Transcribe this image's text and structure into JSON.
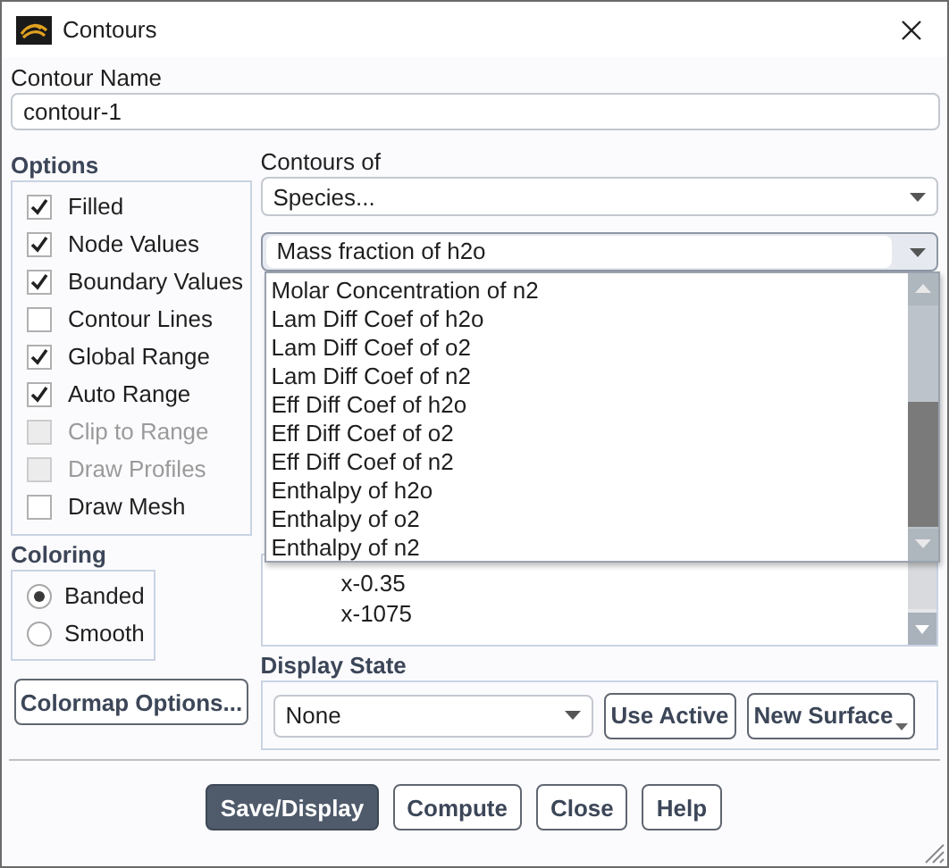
{
  "window": {
    "title": "Contours"
  },
  "contour_name": {
    "label": "Contour Name",
    "value": "contour-1"
  },
  "options": {
    "label": "Options",
    "items": [
      {
        "label": "Filled",
        "checked": true,
        "disabled": false
      },
      {
        "label": "Node Values",
        "checked": true,
        "disabled": false
      },
      {
        "label": "Boundary Values",
        "checked": true,
        "disabled": false
      },
      {
        "label": "Contour Lines",
        "checked": false,
        "disabled": false
      },
      {
        "label": "Global Range",
        "checked": true,
        "disabled": false
      },
      {
        "label": "Auto Range",
        "checked": true,
        "disabled": false
      },
      {
        "label": "Clip to Range",
        "checked": false,
        "disabled": true
      },
      {
        "label": "Draw Profiles",
        "checked": false,
        "disabled": true
      },
      {
        "label": "Draw Mesh",
        "checked": false,
        "disabled": false
      }
    ]
  },
  "coloring": {
    "label": "Coloring",
    "items": [
      {
        "label": "Banded",
        "selected": true
      },
      {
        "label": "Smooth",
        "selected": false
      }
    ]
  },
  "colormap_button": "Colormap Options...",
  "contours_of": {
    "label": "Contours of",
    "category": "Species...",
    "field": "Mass fraction of h2o",
    "expanded": true,
    "options": [
      "Molar Concentration of n2",
      "Lam Diff Coef of h2o",
      "Lam Diff Coef of o2",
      "Lam Diff Coef of n2",
      "Eff Diff Coef of h2o",
      "Eff Diff Coef of o2",
      "Eff Diff Coef of n2",
      "Enthalpy of h2o",
      "Enthalpy of o2",
      "Enthalpy of n2"
    ]
  },
  "surfaces": {
    "items": [
      "x-0.35",
      "x-1075"
    ]
  },
  "display_state": {
    "label": "Display State",
    "value": "None",
    "buttons": [
      "Use Active",
      "New Surface"
    ]
  },
  "buttons": [
    {
      "label": "Save/Display",
      "primary": true
    },
    {
      "label": "Compute",
      "primary": false
    },
    {
      "label": "Close",
      "primary": false
    },
    {
      "label": "Help",
      "primary": false
    }
  ]
}
